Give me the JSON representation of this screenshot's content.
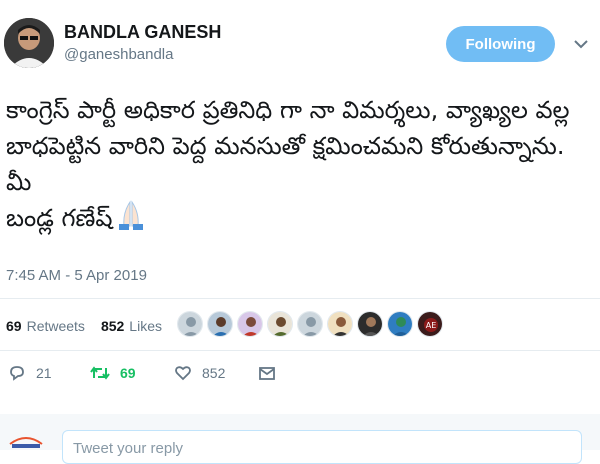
{
  "user": {
    "name": "BANDLA GANESH",
    "handle": "@ganeshbandla",
    "follow_label": "Following"
  },
  "tweet": {
    "text": "కాంగ్రెస్ పార్టీ అధికార ప్రతినిధి గా నా విమర్శలు, వ్యాఖ్యల వల్ల బాధపెట్టిన వారిని పెద్ద మనసుతో క్షమించమని కోరుతున్నాను.\nమీ\nబండ్ల గణేష్",
    "emoji": "folded-hands",
    "timestamp": "7:45 AM - 5 Apr 2019"
  },
  "stats": {
    "retweets_count": "69",
    "retweets_label": "Retweets",
    "likes_count": "852",
    "likes_label": "Likes",
    "liker_avatars": 9
  },
  "actions": {
    "reply_count": "21",
    "retweet_count": "69",
    "like_count": "852"
  },
  "reply": {
    "placeholder": "Tweet your reply"
  },
  "colors": {
    "follow_button": "#71bdf4",
    "retweet_green": "#17bf63",
    "secondary_text": "#657786"
  }
}
